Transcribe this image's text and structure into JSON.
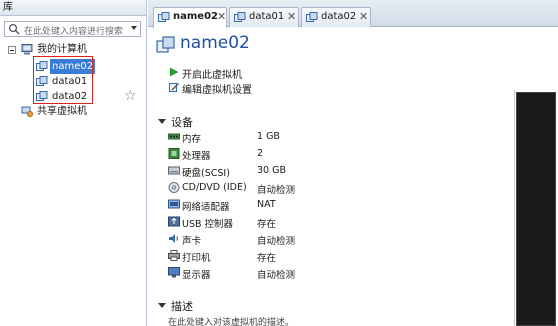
{
  "library": {
    "title": "库",
    "search_placeholder": "在此处键入内容进行搜索",
    "tree": {
      "root_label": "我的计算机",
      "vms": [
        "name02",
        "data01",
        "data02"
      ],
      "selected": "name02",
      "shared_label": "共享虚拟机"
    }
  },
  "tabs": [
    {
      "label": "name02",
      "active": true
    },
    {
      "label": "data01",
      "active": false
    },
    {
      "label": "data02",
      "active": false
    }
  ],
  "vm": {
    "title": "name02",
    "actions": [
      {
        "label": "开启此虚拟机",
        "icon": "play-icon"
      },
      {
        "label": "编辑虚拟机设置",
        "icon": "edit-settings-icon"
      }
    ],
    "devices_header": "设备",
    "devices": [
      {
        "name": "内存",
        "value": "1 GB",
        "icon": "memory-icon"
      },
      {
        "name": "处理器",
        "value": "2",
        "icon": "cpu-icon"
      },
      {
        "name": "硬盘(SCSI)",
        "value": "30 GB",
        "icon": "hard-disk-icon"
      },
      {
        "name": "CD/DVD (IDE)",
        "value": "自动检测",
        "icon": "cd-dvd-icon"
      },
      {
        "name": "网络适配器",
        "value": "NAT",
        "icon": "network-adapter-icon"
      },
      {
        "name": "USB 控制器",
        "value": "存在",
        "icon": "usb-icon"
      },
      {
        "name": "声卡",
        "value": "自动检测",
        "icon": "sound-card-icon"
      },
      {
        "name": "打印机",
        "value": "存在",
        "icon": "printer-icon"
      },
      {
        "name": "显示器",
        "value": "自动检测",
        "icon": "display-icon"
      }
    ],
    "description_header": "描述",
    "description_placeholder": "在此处键入对该虚拟机的描述。"
  },
  "colors": {
    "selection": "#3a7bd5",
    "highlight_box": "#e0201a",
    "title_blue": "#1e4fa0",
    "play_green": "#2e9a2e"
  }
}
